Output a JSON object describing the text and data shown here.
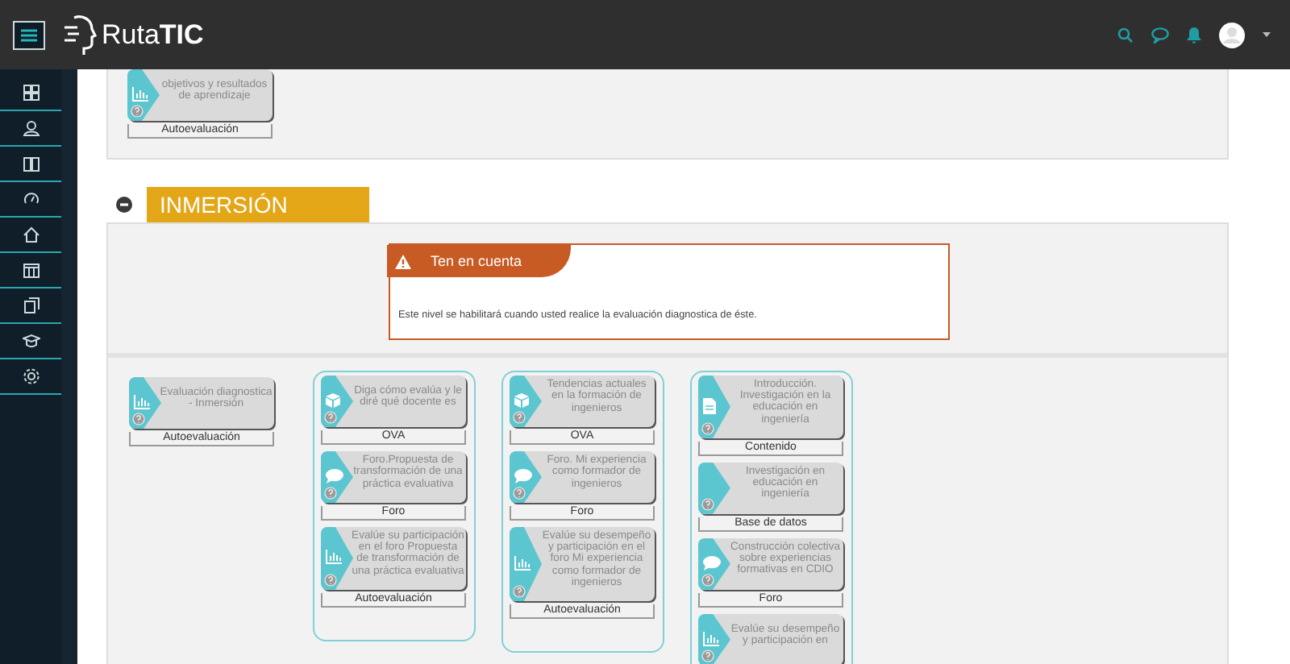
{
  "header": {
    "logo": "Ruta**TIC**"
  },
  "top_section": {
    "cards": [
      {
        "kind": "autoevaluacion",
        "title": "objetivos y resultados de aprendizaje",
        "label": "Autoevaluación"
      }
    ]
  },
  "section": {
    "title": "INMERSIÓN",
    "expanded": true,
    "notice": {
      "title": "Ten en cuenta",
      "text": "Este nivel se habilitará cuando usted realice la evaluación diagnostica de éste."
    },
    "columns": [
      {
        "grouped": false,
        "cards": [
          {
            "kind": "autoevaluacion",
            "title": "Evaluación diagnostica - Inmersión",
            "label": "Autoevaluación"
          }
        ]
      },
      {
        "grouped": true,
        "cards": [
          {
            "kind": "ova",
            "title": "Diga cómo evalúa y le diré qué docente es",
            "label": "OVA"
          },
          {
            "kind": "foro",
            "title": "Foro.Propuesta de transformación de una práctica evaluativa",
            "label": "Foro"
          },
          {
            "kind": "autoevaluacion",
            "title": "Evalúe su participación en el foro Propuesta de transformación de una práctica evaluativa",
            "label": "Autoevaluación"
          }
        ]
      },
      {
        "grouped": true,
        "cards": [
          {
            "kind": "ova",
            "title": "Tendencias actuales en la formación de ingenieros",
            "label": "OVA"
          },
          {
            "kind": "foro",
            "title": "Foro. Mi experiencia como formador de ingenieros",
            "label": "Foro"
          },
          {
            "kind": "autoevaluacion",
            "title": "Evalúe su desempeño y participación en el foro Mi experiencia como formador de ingenieros",
            "label": "Autoevaluación"
          }
        ]
      },
      {
        "grouped": true,
        "cards": [
          {
            "kind": "contenido",
            "title": "Introducción. Investigación en la educación en ingeniería",
            "label": "Contenido"
          },
          {
            "kind": "base_datos",
            "title": "Investigación en educación en ingeniería",
            "label": "Base de datos"
          },
          {
            "kind": "foro",
            "title": "Construcción colectiva sobre experiencias formativas en CDIO",
            "label": "Foro"
          },
          {
            "kind": "autoevaluacion",
            "title": "Evalúe su desempeño y participación en"
          }
        ]
      }
    ]
  }
}
